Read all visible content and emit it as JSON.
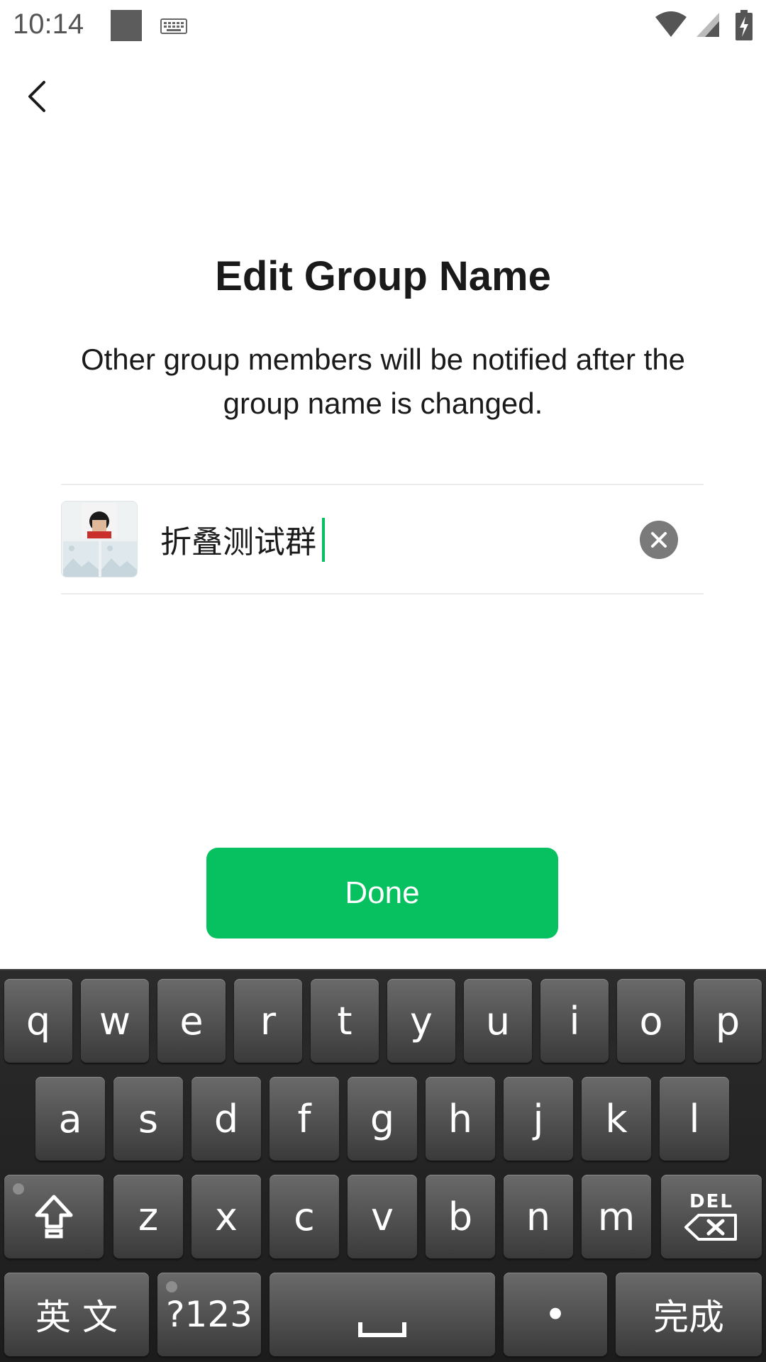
{
  "status_bar": {
    "time": "10:14"
  },
  "header": {
    "back_icon": "chevron-left-icon"
  },
  "main": {
    "title": "Edit Group Name",
    "subtitle": "Other group members will be notified after the group name is changed.",
    "group_name_value": "折叠测试群",
    "done_label": "Done"
  },
  "colors": {
    "accent": "#07c160",
    "keyboard_bg": "#1f1f1f"
  },
  "keyboard": {
    "row1": [
      "q",
      "w",
      "e",
      "r",
      "t",
      "y",
      "u",
      "i",
      "o",
      "p"
    ],
    "row2": [
      "a",
      "s",
      "d",
      "f",
      "g",
      "h",
      "j",
      "k",
      "l"
    ],
    "row3": [
      "z",
      "x",
      "c",
      "v",
      "b",
      "n",
      "m"
    ],
    "del_label": "DEL",
    "lang_label": "英 文",
    "symbols_label": "?123",
    "period_label": "•",
    "enter_label": "完成"
  }
}
